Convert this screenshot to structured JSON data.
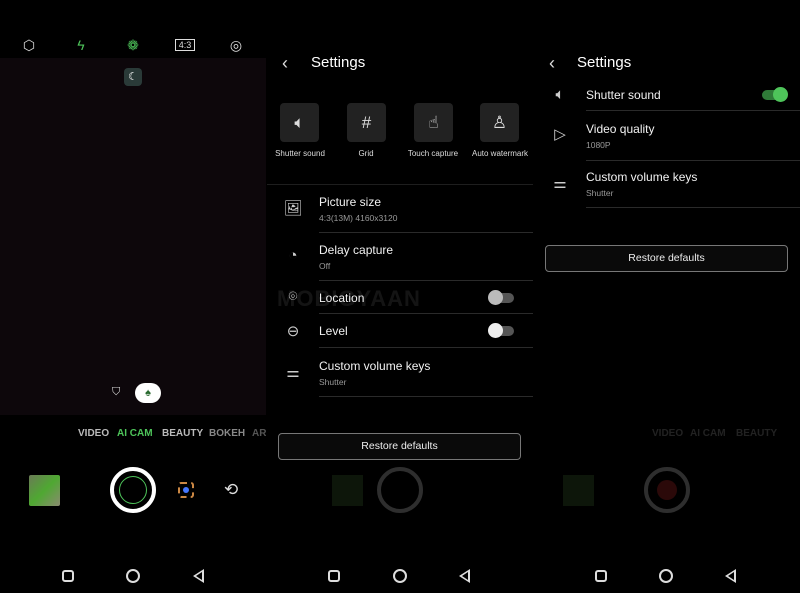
{
  "camera": {
    "top_icons": [
      "settings-hex-icon",
      "flash-auto-icon",
      "ai-scene-icon",
      "aspect-ratio-icon",
      "filter-icon"
    ],
    "aspect_label": "4:3",
    "modes": [
      "VIDEO",
      "AI CAM",
      "BEAUTY",
      "BOKEH",
      "AR"
    ],
    "active_mode": "AI CAM",
    "accent": "#4ec45a"
  },
  "settings_a": {
    "title": "Settings",
    "tiles": [
      {
        "label": "Shutter sound",
        "active": true
      },
      {
        "label": "Grid",
        "active": false
      },
      {
        "label": "Touch capture",
        "active": false
      },
      {
        "label": "Auto watermark",
        "active": true
      }
    ],
    "rows": [
      {
        "title": "Picture size",
        "sub": "4:3(13M) 4160x3120"
      },
      {
        "title": "Delay capture",
        "sub": "Off"
      },
      {
        "title": "Location",
        "toggle": false
      },
      {
        "title": "Level",
        "toggle": false
      },
      {
        "title": "Custom volume keys",
        "sub": "Shutter"
      }
    ],
    "restore": "Restore defaults"
  },
  "settings_b": {
    "title": "Settings",
    "rows": [
      {
        "title": "Shutter sound",
        "toggle": true
      },
      {
        "title": "Video quality",
        "sub": "1080P"
      },
      {
        "title": "Custom volume keys",
        "sub": "Shutter"
      }
    ],
    "restore": "Restore defaults"
  },
  "watermark": "MOBIGYAAN"
}
